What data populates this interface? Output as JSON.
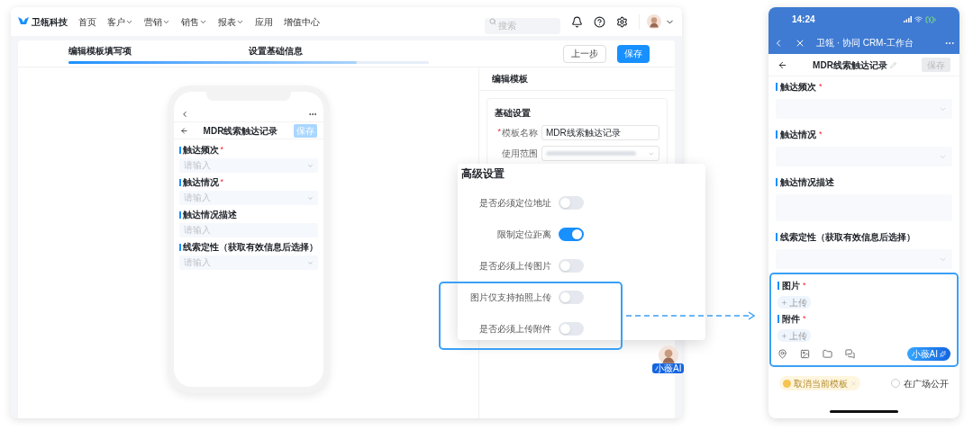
{
  "nav": {
    "logo": "卫瓴科技",
    "items": [
      {
        "label": "首页",
        "dropdown": false
      },
      {
        "label": "客户",
        "dropdown": true
      },
      {
        "label": "营销",
        "dropdown": true
      },
      {
        "label": "销售",
        "dropdown": true
      },
      {
        "label": "报表",
        "dropdown": true
      },
      {
        "label": "应用",
        "dropdown": false
      },
      {
        "label": "增值中心",
        "dropdown": false
      }
    ],
    "search": {
      "placeholder": "搜索"
    }
  },
  "steps": [
    {
      "label": "编辑模板填写项"
    },
    {
      "label": "设置基础信息"
    }
  ],
  "progress": {
    "level": 0.8
  },
  "header_buttons": [
    {
      "label": "上一步",
      "kind": "secondary"
    },
    {
      "label": "保存",
      "kind": "primary"
    }
  ],
  "preview": {
    "title": "MDR线索触达记录",
    "save": "保存",
    "fields": [
      {
        "label": "触达频次",
        "required_mark": "*",
        "placeholder": "请输入",
        "kind": "select"
      },
      {
        "label": "触达情况",
        "required_mark": "*",
        "placeholder": "请输入",
        "kind": "select"
      },
      {
        "label": "触达情况描述",
        "placeholder": "请输入",
        "kind": "text"
      },
      {
        "label": "线索定性（获取有效信息后选择）",
        "placeholder": "请输入",
        "kind": "select"
      }
    ]
  },
  "editor": {
    "title": "编辑模板",
    "section": "基础设置",
    "fields": [
      {
        "label": "模板名称",
        "required_mark": "*",
        "value": "MDR线索触达记录",
        "kind": "text"
      },
      {
        "label": "使用范围",
        "kind": "select"
      }
    ]
  },
  "advanced": {
    "title": "高级设置",
    "toggles": [
      {
        "label": "是否必须定位地址",
        "on": false
      },
      {
        "label": "限制定位距离",
        "on": true
      },
      {
        "label": "是否必须上传图片",
        "on": false
      },
      {
        "label": "图片仅支持拍照上传",
        "on": false
      },
      {
        "label": "是否必须上传附件",
        "on": false
      }
    ]
  },
  "assistant": {
    "label": "小薇AI"
  },
  "mobile": {
    "time": "14:24",
    "app_title": "卫瓴 · 协同 CRM-工作台",
    "page_title": "MDR线索触达记录",
    "save": "保存",
    "fields": [
      {
        "label": "触达频次",
        "required_mark": "*",
        "kind": "select"
      },
      {
        "label": "触达情况",
        "required_mark": "*",
        "kind": "select"
      },
      {
        "label": "触达情况描述",
        "kind": "text"
      },
      {
        "label": "线索定性（获取有效信息后选择）",
        "kind": "select"
      }
    ],
    "uploads": [
      {
        "label": "图片",
        "required_mark": "*",
        "button": "上传"
      },
      {
        "label": "附件",
        "required_mark": "*",
        "button": "上传"
      }
    ],
    "ai_button": "小薇AI",
    "template_chip": "取消当前模板",
    "public": {
      "label": "在广场公开",
      "checked": false
    }
  }
}
